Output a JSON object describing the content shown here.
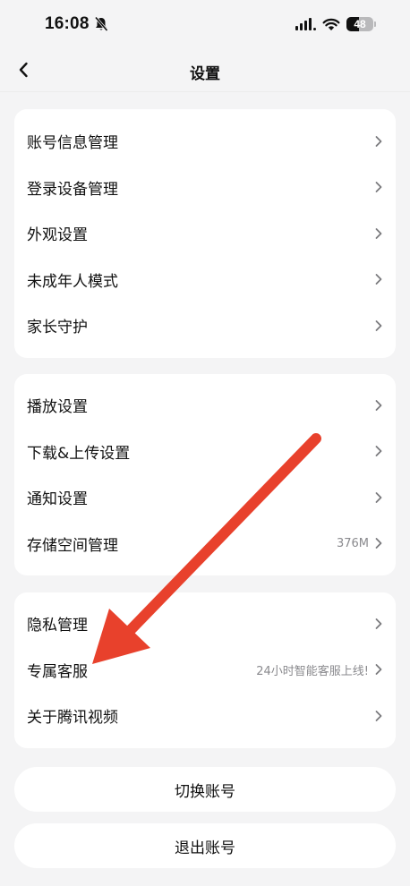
{
  "status_bar": {
    "time": "16:08",
    "battery": "48",
    "battery_level": 0.48
  },
  "nav": {
    "title": "设置"
  },
  "groups": [
    {
      "items": [
        {
          "label": "账号信息管理",
          "value": ""
        },
        {
          "label": "登录设备管理",
          "value": ""
        },
        {
          "label": "外观设置",
          "value": ""
        },
        {
          "label": "未成年人模式",
          "value": ""
        },
        {
          "label": "家长守护",
          "value": ""
        }
      ]
    },
    {
      "items": [
        {
          "label": "播放设置",
          "value": ""
        },
        {
          "label": "下载&上传设置",
          "value": ""
        },
        {
          "label": "通知设置",
          "value": ""
        },
        {
          "label": "存储空间管理",
          "value": "376M"
        }
      ]
    },
    {
      "items": [
        {
          "label": "隐私管理",
          "value": ""
        },
        {
          "label": "专属客服",
          "value": "24小时智能客服上线!"
        },
        {
          "label": "关于腾讯视频",
          "value": ""
        }
      ]
    }
  ],
  "buttons": {
    "switch_account": "切换账号",
    "logout": "退出账号"
  },
  "annotation": {
    "arrow_color": "#e8412c"
  }
}
